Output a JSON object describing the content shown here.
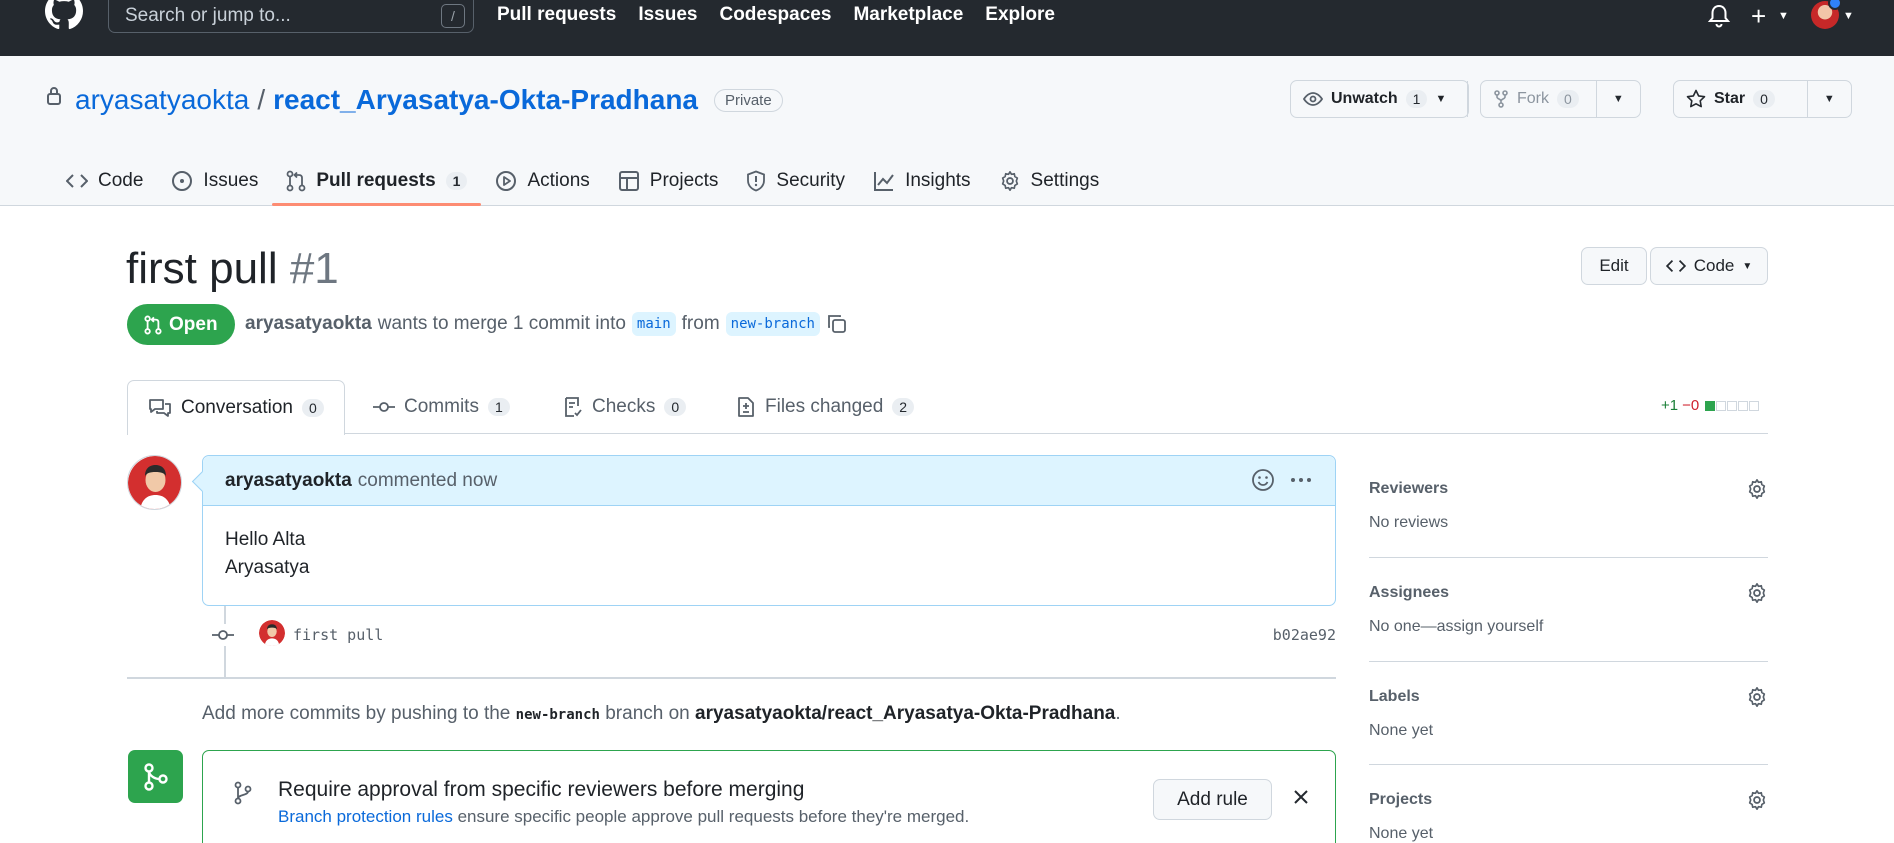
{
  "header": {
    "search_placeholder": "Search or jump to...",
    "search_shortcut": "/",
    "nav": [
      "Pull requests",
      "Issues",
      "Codespaces",
      "Marketplace",
      "Explore"
    ],
    "plus_symbol": "+"
  },
  "repo": {
    "owner": "aryasatyaokta",
    "separator": "/",
    "name": "react_Aryasatya-Okta-Pradhana",
    "visibility": "Private",
    "unwatch_label": "Unwatch",
    "watch_count": "1",
    "fork_label": "Fork",
    "fork_count": "0",
    "star_label": "Star",
    "star_count": "0"
  },
  "repo_tabs": [
    {
      "label": "Code"
    },
    {
      "label": "Issues"
    },
    {
      "label": "Pull requests",
      "count": "1",
      "active": true
    },
    {
      "label": "Actions"
    },
    {
      "label": "Projects"
    },
    {
      "label": "Security"
    },
    {
      "label": "Insights"
    },
    {
      "label": "Settings"
    }
  ],
  "pr": {
    "title": "first pull",
    "number": "#1",
    "edit_label": "Edit",
    "code_label": "Code",
    "state": "Open",
    "author": "aryasatyaokta",
    "meta_text": "wants to merge 1 commit into",
    "base_branch": "main",
    "from_text": "from",
    "head_branch": "new-branch"
  },
  "pr_tabs": [
    {
      "label": "Conversation",
      "count": "0",
      "active": true
    },
    {
      "label": "Commits",
      "count": "1"
    },
    {
      "label": "Checks",
      "count": "0"
    },
    {
      "label": "Files changed",
      "count": "2"
    }
  ],
  "diffstat": {
    "additions": "+1",
    "deletions": "−0",
    "blocks": [
      1,
      0,
      0,
      0,
      0
    ]
  },
  "comment": {
    "author": "aryasatyaokta",
    "action": "commented now",
    "body_lines": [
      "Hello Alta",
      "Aryasatya"
    ]
  },
  "commit": {
    "message": "first pull",
    "sha": "b02ae92"
  },
  "push_hint": {
    "prefix": "Add more commits by pushing to the",
    "branch": "new-branch",
    "middle": "branch on",
    "repo": "aryasatyaokta/react_Aryasatya-Okta-Pradhana",
    "suffix": "."
  },
  "merge_box": {
    "title": "Require approval from specific reviewers before merging",
    "link_text": "Branch protection rules",
    "sub_text": "ensure specific people approve pull requests before they're merged.",
    "button": "Add rule"
  },
  "sidebar": [
    {
      "label": "Reviewers",
      "value": "No reviews"
    },
    {
      "label": "Assignees",
      "value": "No one—assign yourself"
    },
    {
      "label": "Labels",
      "value": "None yet"
    },
    {
      "label": "Projects",
      "value": "None yet"
    }
  ],
  "colors": {
    "header_bg": "#24292f",
    "accent_blue": "#0969da",
    "open_green": "#2da44e",
    "tab_underline": "#fd8c73",
    "comment_header": "#ddf4ff"
  }
}
